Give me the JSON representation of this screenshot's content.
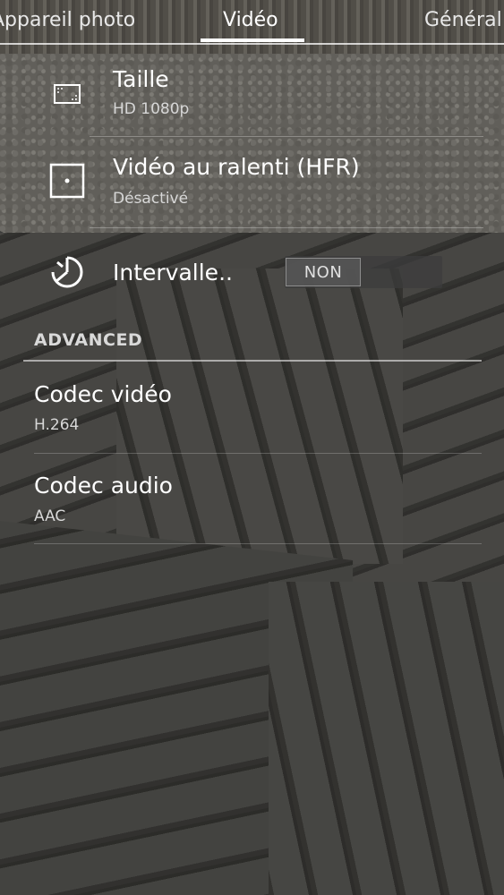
{
  "tabs": {
    "photo": "Appareil photo",
    "video": "Vidéo",
    "general": "Général"
  },
  "video_settings": {
    "size": {
      "title": "Taille",
      "value": "HD 1080p",
      "icon": "video-size-icon"
    },
    "slowmo": {
      "title": "Vidéo au ralenti (HFR)",
      "value": "Désactivé",
      "icon": "slow-motion-icon"
    },
    "interval": {
      "title": "Intervalle..",
      "toggle_label": "NON",
      "icon": "timelapse-icon"
    }
  },
  "advanced": {
    "header": "ADVANCED",
    "video_codec": {
      "title": "Codec vidéo",
      "value": "H.264"
    },
    "audio_codec": {
      "title": "Codec audio",
      "value": "AAC"
    }
  }
}
